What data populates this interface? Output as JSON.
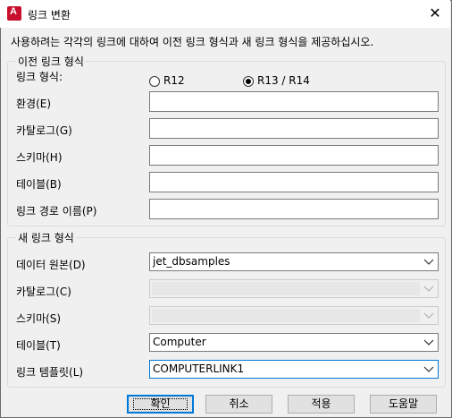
{
  "window": {
    "title": "링크 변환",
    "close_glyph": "✕"
  },
  "description": "사용하려는 각각의 링크에 대하여 이전 링크 형식과 새 링크 형식을 제공하십시오.",
  "old_format": {
    "group_label": "이전 링크 형식",
    "link_type_label": "링크 형식:",
    "radio_r12": "R12",
    "radio_r13": "R13 / R14",
    "selected": "R13 / R14",
    "env_label": "환경(E)",
    "catalog_label": "카탈로그(G)",
    "schema_label": "스키마(H)",
    "table_label": "테이블(B)",
    "path_label": "링크 경로 이름(P)",
    "env_value": "",
    "catalog_value": "",
    "schema_value": "",
    "table_value": "",
    "path_value": ""
  },
  "new_format": {
    "group_label": "새 링크 형식",
    "source_label": "데이터 원본(D)",
    "source_value": "jet_dbsamples",
    "catalog_label": "카탈로그(C)",
    "catalog_value": "",
    "schema_label": "스키마(S)",
    "schema_value": "",
    "table_label": "테이블(T)",
    "table_value": "Computer",
    "template_label": "링크 템플릿(L)",
    "template_value": "COMPUTERLINK1"
  },
  "buttons": {
    "ok": "확인",
    "cancel": "취소",
    "apply": "적용",
    "help": "도움말"
  },
  "colors": {
    "accent": "#0078d7",
    "app_icon": "#c8102e"
  }
}
